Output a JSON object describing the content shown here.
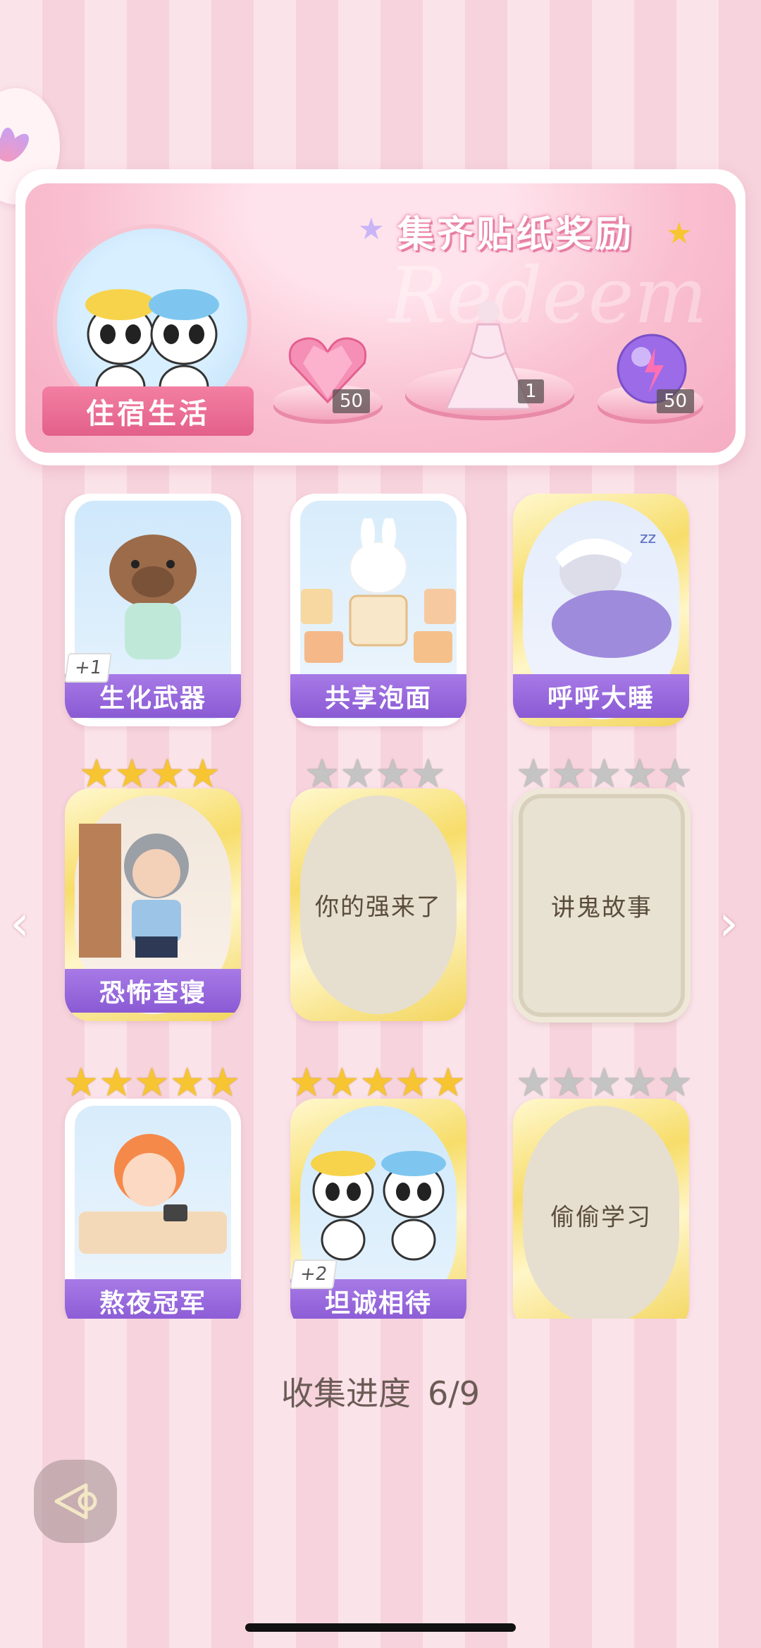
{
  "banner": {
    "title": "集齐贴纸奖励",
    "watermark": "Redeem",
    "featured_sticker": "住宿生活",
    "rewards": [
      {
        "icon": "pink-heart-gem-icon",
        "count": "50"
      },
      {
        "icon": "wedding-dress-icon",
        "count": "1"
      },
      {
        "icon": "purple-energy-orb-icon",
        "count": "50"
      }
    ]
  },
  "stickers": [
    {
      "name": "生化武器",
      "state": "collected",
      "badge": "+1",
      "stars": 0
    },
    {
      "name": "共享泡面",
      "state": "collected",
      "badge": "",
      "stars": 0
    },
    {
      "name": "呼呼大睡",
      "state": "collected",
      "badge": "",
      "stars": 0
    },
    {
      "name": "恐怖查寝",
      "state": "collected",
      "badge": "",
      "stars": 4
    },
    {
      "name": "你的强来了",
      "state": "locked",
      "badge": "",
      "stars": 4
    },
    {
      "name": "讲鬼故事",
      "state": "locked",
      "badge": "",
      "stars": 5
    },
    {
      "name": "熬夜冠军",
      "state": "collected",
      "badge": "",
      "stars": 5
    },
    {
      "name": "坦诚相待",
      "state": "collected",
      "badge": "+2",
      "stars": 5
    },
    {
      "name": "偷偷学习",
      "state": "locked",
      "badge": "",
      "stars": 5
    }
  ],
  "progress": {
    "label": "收集进度",
    "value": "6/9"
  },
  "colors": {
    "accent": "#8a5ad4",
    "star": "#f7c531",
    "background": "#fbe3ea"
  }
}
